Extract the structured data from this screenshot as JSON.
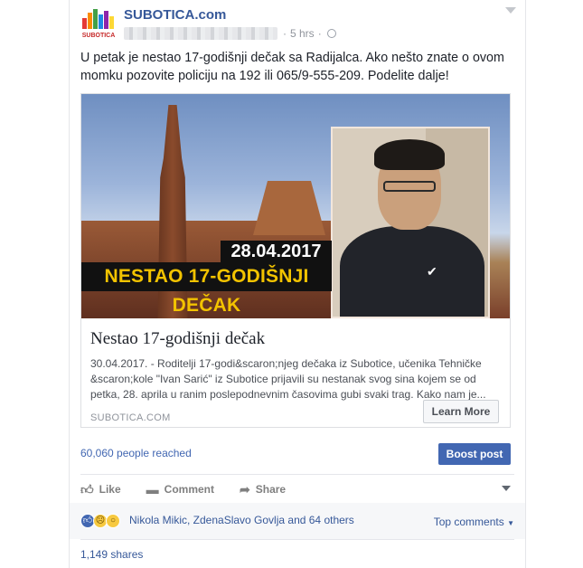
{
  "post": {
    "page_name": "SUBOTICA.com",
    "time": "5 hrs",
    "separator": "·",
    "text": "U petak je nestao 17-godišnji dečak sa Radijalca. Ako nešto znate o ovom momku pozovite policiju na 192 ili 065/9-555-209. Podelite dalje!"
  },
  "logo": {
    "text": "SUBOTICA"
  },
  "link_card": {
    "image_date": "28.04.2017",
    "image_title": "NESTAO 17-GODIŠNJI DEČAK",
    "title": "Nestao 17-godišnji dečak",
    "description": "30.04.2017. - Roditelji 17-godi&scaron;njeg dečaka iz Subotice, učenika Tehničke &scaron;kole \"Ivan Sarić\" iz Subotice prijavili su nestanak svog sina kojem se od petka, 28. aprila u ranim poslepodnevnim časovima gubi svaki trag. Kako nam je...",
    "domain": "SUBOTICA.COM",
    "cta": "Learn More"
  },
  "stats": {
    "reached": "60,060 people reached",
    "boost": "Boost post"
  },
  "actions": {
    "like": "Like",
    "comment": "Comment",
    "share": "Share"
  },
  "reactions": {
    "names": "Nikola Mikic, ZdenaSlavo Govlja and 64 others",
    "top_comments": "Top comments",
    "shares": "1,149 shares"
  },
  "colors": {
    "link": "#365899",
    "boost": "#4267b2",
    "image_title": "#f2c300"
  }
}
